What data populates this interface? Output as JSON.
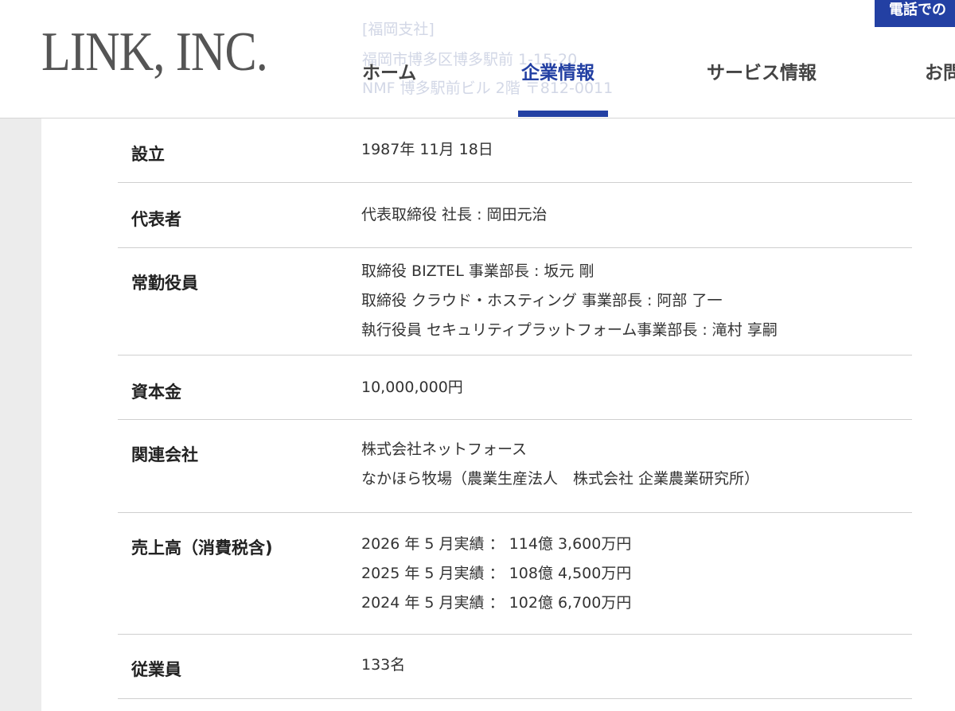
{
  "header": {
    "logo_text": "LINK, INC.",
    "office_label": "[福岡支社]",
    "office_address_1": "福岡市博多区博多駅前 1-15-20",
    "office_address_2": "NMF 博多駅前ビル 2階 〒812-0011",
    "phone_button_label": "電話での"
  },
  "nav": {
    "home": "ホーム",
    "company": "企業情報",
    "service": "サービス情報",
    "contact": "お問"
  },
  "company_info": {
    "established": {
      "label": "設立",
      "value": "1987年 11月 18日"
    },
    "representative": {
      "label": "代表者",
      "value": "代表取締役 社長 : 岡田元治"
    },
    "officers": {
      "label": "常勤役員",
      "values": [
        "取締役 BIZTEL 事業部長 : 坂元 剛",
        "取締役 クラウド・ホスティング 事業部長 : 阿部 了一",
        "執行役員 セキュリティプラットフォーム事業部長 : 滝村 享嗣"
      ]
    },
    "capital": {
      "label": "資本金",
      "value": "10,000,000円"
    },
    "affiliates": {
      "label": "関連会社",
      "values": [
        "株式会社ネットフォース",
        "なかほら牧場（農業生産法人　株式会社 企業農業研究所）"
      ]
    },
    "sales": {
      "label": "売上高（消費税含)",
      "values": [
        "2026 年 5 月実績 ： 114億 3,600万円",
        "2025 年 5 月実績 ： 108億 4,500万円",
        "2024 年 5 月実績 ： 102億 6,700万円"
      ]
    },
    "employees": {
      "label": "従業員",
      "value": "133名"
    }
  }
}
